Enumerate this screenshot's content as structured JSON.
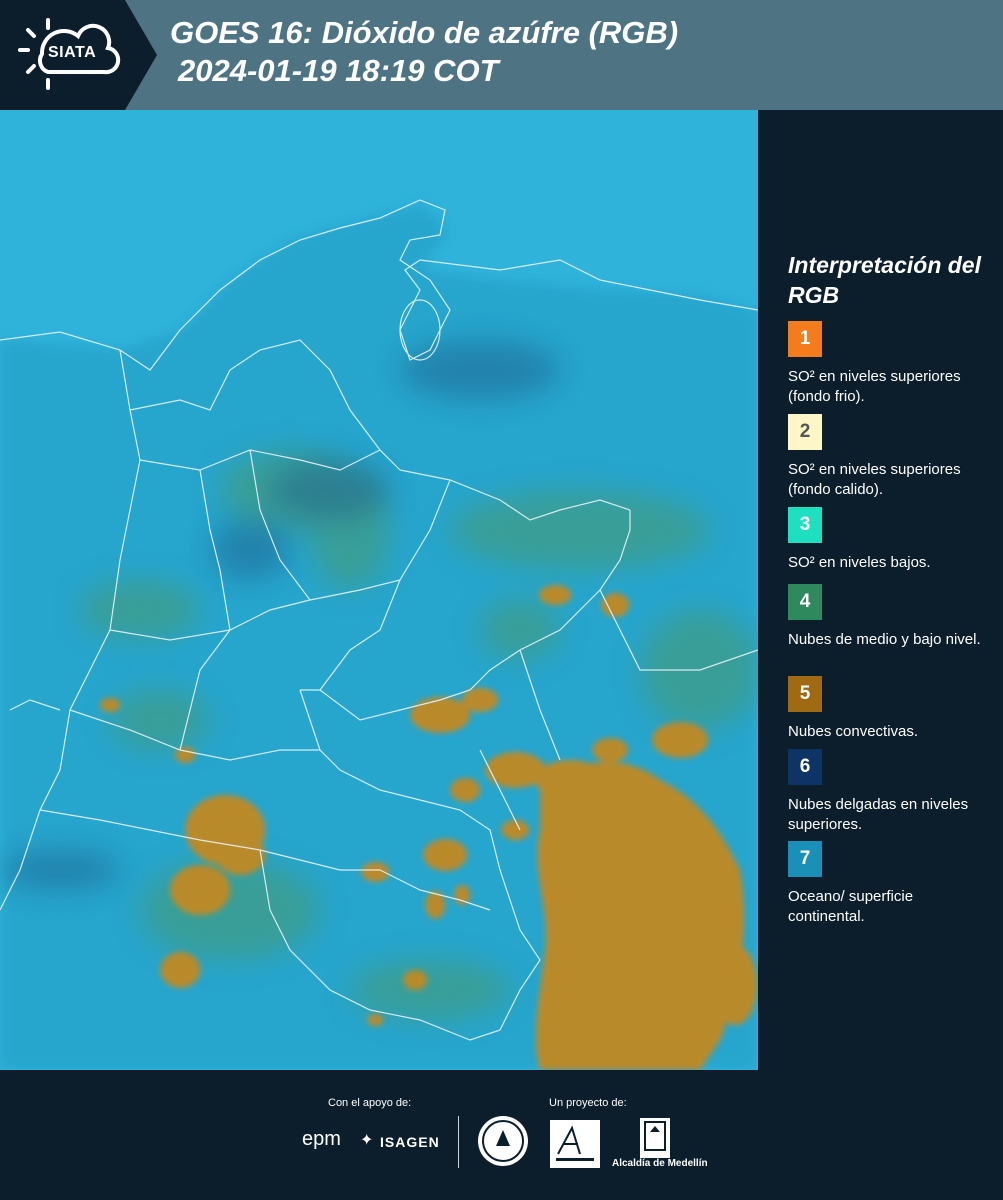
{
  "header": {
    "logo_text": "SIATA",
    "title_line1": "GOES 16: Dióxido de azúfre (RGB)",
    "title_line2": "2024-01-19 18:19 COT",
    "bg_color": "#4e7484"
  },
  "legend": {
    "title": "Interpretación del RGB",
    "items": [
      {
        "number": "1",
        "color": "#f57c1c",
        "text_color": "#ffffff",
        "label": "SO² en niveles superiores (fondo frio)."
      },
      {
        "number": "2",
        "color": "#fdf6c6",
        "text_color": "#555555",
        "label": "SO² en niveles superiores (fondo calido)."
      },
      {
        "number": "3",
        "color": "#1ee0c0",
        "text_color": "#ffffff",
        "label": "SO² en niveles bajos."
      },
      {
        "number": "4",
        "color": "#2e8a5c",
        "text_color": "#ffffff",
        "label": "Nubes de medio y bajo nivel."
      },
      {
        "number": "5",
        "color": "#a06a12",
        "text_color": "#ffffff",
        "label": "Nubes convectivas."
      },
      {
        "number": "6",
        "color": "#0e3466",
        "text_color": "#ffffff",
        "label": "Nubes delgadas en niveles superiores."
      },
      {
        "number": "7",
        "color": "#1a8fb8",
        "text_color": "#ffffff",
        "label": "Oceano/ superficie continental."
      }
    ]
  },
  "footer": {
    "support_label": "Con el apoyo de:",
    "project_label": "Un proyecto de:",
    "epm": "epm",
    "isagen": "ISAGEN",
    "alcaldia": "Alcaldía de Medellín"
  },
  "map": {
    "ocean_color": "#2fb3db",
    "land_color": "#27a6cf",
    "cloud_color": "#b98a2a",
    "border_color": "#e8f3f8"
  }
}
